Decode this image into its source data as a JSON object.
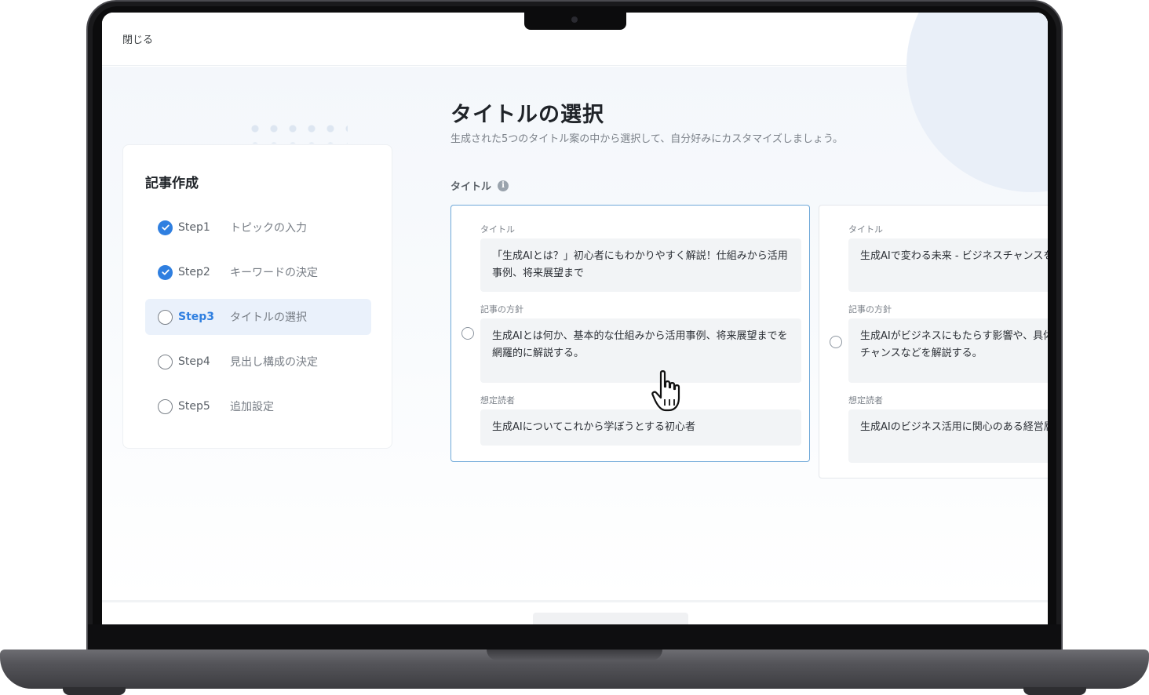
{
  "app": {
    "close_label": "閉じる"
  },
  "sidebar": {
    "title": "記事作成",
    "steps": [
      {
        "num": "Step1",
        "label": "トピックの入力",
        "status": "done"
      },
      {
        "num": "Step2",
        "label": "キーワードの決定",
        "status": "done"
      },
      {
        "num": "Step3",
        "label": "タイトルの選択",
        "status": "active"
      },
      {
        "num": "Step4",
        "label": "見出し構成の決定",
        "status": "todo"
      },
      {
        "num": "Step5",
        "label": "追加設定",
        "status": "todo"
      }
    ]
  },
  "main": {
    "title": "タイトルの選択",
    "subtitle": "生成された5つのタイトル案の中から選択して、自分好みにカスタマイズしましょう。",
    "section_label": "タイトル",
    "info_icon": "i",
    "options": [
      {
        "title_label": "タイトル",
        "title": "「生成AIとは？」初心者にもわかりやすく解説！仕組みから活用事例、将来展望まで",
        "policy_label": "記事の方針",
        "policy": "生成AIとは何か、基本的な仕組みから活用事例、将来展望までを網羅的に解説する。",
        "reader_label": "想定読者",
        "reader": "生成AIについてこれから学ぼうとする初心者"
      },
      {
        "title_label": "タイトル",
        "title": "生成AIで変わる未来 - ビジネスチャンスを徹底解説",
        "policy_label": "記事の方針",
        "policy": "生成AIがビジネスにもたらす影響や、具体的な未来的なビジネスチャンスなどを解説する。",
        "reader_label": "想定読者",
        "reader": "生成AIのビジネス活用に関心のある経営層・ビジネスパーソン"
      }
    ]
  },
  "colors": {
    "accent": "#2f7fe0",
    "active_bg": "#eaf1fb",
    "card_border_hover": "#6ea8d8"
  },
  "icons": {
    "check": "check-circle-icon",
    "pending": "empty-circle-icon",
    "cursor": "hand-pointer-icon"
  }
}
